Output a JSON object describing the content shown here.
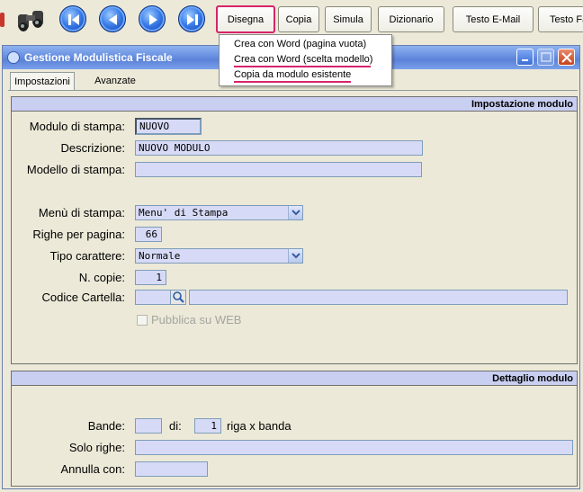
{
  "toolbar": {
    "buttons": [
      "Disegna",
      "Copia",
      "Simula",
      "Dizionario",
      "Testo E-Mail",
      "Testo Fa"
    ],
    "nav_icons": [
      "first-record-icon",
      "prev-record-icon",
      "next-record-icon",
      "last-record-icon"
    ],
    "active_button": "Disegna",
    "accent_color": "#d6246a"
  },
  "menu": {
    "items": [
      "Crea con Word (pagina vuota)",
      "Crea con Word (scelta modello)",
      "Copia da modulo esistente"
    ]
  },
  "window": {
    "title": "Gestione Modulistica Fiscale",
    "tabs": [
      "Impostazioni",
      "Avanzate"
    ]
  },
  "impostazione": {
    "header": "Impostazione modulo",
    "labels": {
      "modulo": "Modulo di stampa:",
      "descrizione": "Descrizione:",
      "modello": "Modello di stampa:",
      "menu": "Menù di stampa:",
      "righe": "Righe per pagina:",
      "tipo": "Tipo carattere:",
      "copie": "N. copie:",
      "cartella": "Codice Cartella:",
      "pubblica": "Pubblica su WEB"
    },
    "values": {
      "modulo": "NUOVO",
      "descrizione": "NUOVO MODULO",
      "modello": "",
      "menu": "Menu' di Stampa",
      "righe": "66",
      "tipo": "Normale",
      "copie": "1",
      "cartella_codice": "",
      "cartella_desc": ""
    }
  },
  "dettaglio": {
    "header": "Dettaglio modulo",
    "labels": {
      "bande": "Bande:",
      "di": "di:",
      "riga_banda": "riga x banda",
      "solo_righe": "Solo righe:",
      "annulla": "Annulla con:"
    },
    "values": {
      "bande": "",
      "di": "1",
      "solo_righe": "",
      "annulla": ""
    }
  }
}
